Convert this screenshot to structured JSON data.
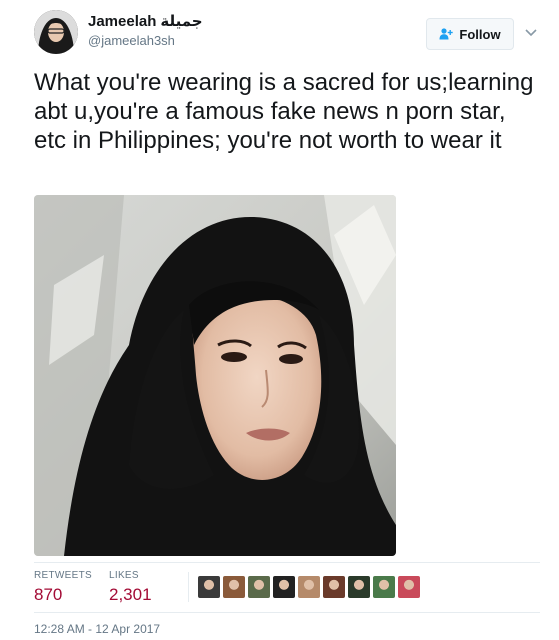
{
  "author": {
    "display_name": "Jameelah",
    "display_name_arabic": "جميلة",
    "handle": "@jameelah3sh"
  },
  "follow_button": {
    "label": "Follow",
    "icon": "follow-user-plus-icon"
  },
  "tweet": {
    "text": "What you're wearing is a sacred for us;learning abt u,you're a famous fake news n porn star, etc in Philippines; you're not worth to wear it",
    "media_alt": "woman-in-black-hijab-photo"
  },
  "stats": {
    "retweets_label": "RETWEETS",
    "retweets_value": "870",
    "likes_label": "LIKES",
    "likes_value": "2,301"
  },
  "likers": [
    {
      "name": "liker-avatar-1",
      "color": "#3a3a3a"
    },
    {
      "name": "liker-avatar-2",
      "color": "#8a5a3a"
    },
    {
      "name": "liker-avatar-3",
      "color": "#5a6a4a"
    },
    {
      "name": "liker-avatar-4",
      "color": "#222222"
    },
    {
      "name": "liker-avatar-5",
      "color": "#b58a6a"
    },
    {
      "name": "liker-avatar-6",
      "color": "#6a3a2a"
    },
    {
      "name": "liker-avatar-7",
      "color": "#2a3a2a"
    },
    {
      "name": "liker-avatar-8",
      "color": "#4a7a4a"
    },
    {
      "name": "liker-avatar-9",
      "color": "#c94a5a"
    }
  ],
  "timestamp": "12:28 AM - 12 Apr 2017",
  "colors": {
    "stat_value": "#a30b35",
    "muted": "#657786",
    "text": "#14171a",
    "follow_icon": "#1da1f2"
  }
}
